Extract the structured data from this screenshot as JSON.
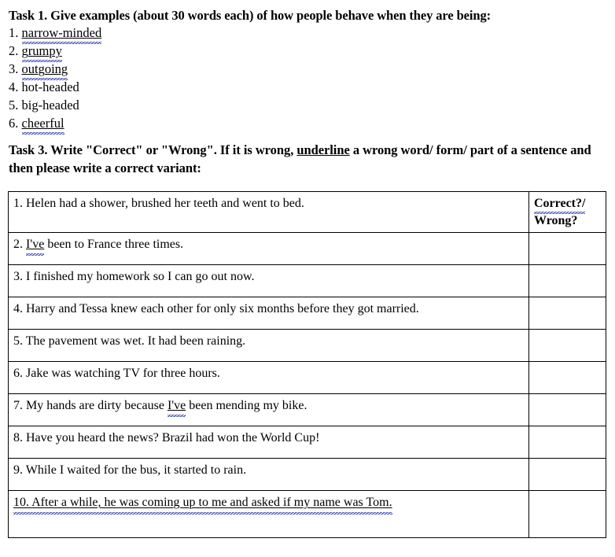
{
  "task1": {
    "heading": "Task 1. Give examples (about 30 words each) of how people behave when they are being:",
    "items": [
      {
        "number": "1.",
        "text": "narrow-minded",
        "underline": "solid-wavy"
      },
      {
        "number": "2.",
        "text": "grumpy",
        "underline": "solid-wavy"
      },
      {
        "number": "3.",
        "text": "outgoing",
        "underline": "solid-wavy"
      },
      {
        "number": "4.",
        "text": "hot-headed",
        "underline": "none"
      },
      {
        "number": "5.",
        "text": "big-headed",
        "underline": "none"
      },
      {
        "number": "6.",
        "text": "cheerful",
        "underline": "solid-wavy"
      }
    ]
  },
  "task3": {
    "heading_part1": "Task 3. Write \"Correct\" or \"Wrong\". If it is wrong, ",
    "heading_underlined": "underline",
    "heading_part2": " a wrong word/ form/ part of a sentence and then please write a correct variant:",
    "table": {
      "answer_header_line1": "Correct?/",
      "answer_header_line2": "Wrong?",
      "rows": [
        {
          "number": "1.",
          "sentence": "Helen had a shower, brushed her teeth and went to bed.",
          "answer": "",
          "marked_word": "",
          "fully_underlined": false
        },
        {
          "number": "2.",
          "sentence_before": "",
          "marked_word": "I've",
          "sentence_after": " been to France three times.",
          "sentence": "I've been to France three times.",
          "answer": "",
          "fully_underlined": false
        },
        {
          "number": "3.",
          "sentence": "I finished my homework so I can go out now.",
          "answer": "",
          "marked_word": "",
          "fully_underlined": false
        },
        {
          "number": "4.",
          "sentence": "Harry and Tessa knew each other for only six months before they got married.",
          "answer": "",
          "marked_word": "",
          "fully_underlined": false
        },
        {
          "number": "5.",
          "sentence": "The pavement was wet. It had been raining.",
          "answer": "",
          "marked_word": "",
          "fully_underlined": false
        },
        {
          "number": "6.",
          "sentence": "Jake was watching TV for three hours.",
          "answer": "",
          "marked_word": "",
          "fully_underlined": false
        },
        {
          "number": "7.",
          "sentence_before": "My hands are dirty because ",
          "marked_word": "I've",
          "sentence_after": " been mending my bike.",
          "sentence": "My hands are dirty because I've been mending my bike.",
          "answer": "",
          "fully_underlined": false
        },
        {
          "number": "8.",
          "sentence": "Have you heard the news? Brazil had won the World Cup!",
          "answer": "",
          "marked_word": "",
          "fully_underlined": false
        },
        {
          "number": "9.",
          "sentence": "While I waited for the bus, it started to rain.",
          "answer": "",
          "marked_word": "",
          "fully_underlined": false
        },
        {
          "number": "10.",
          "sentence": "After a while, he was coming up to me and asked if my name was Tom.",
          "answer": "",
          "marked_word": "",
          "fully_underlined": true
        }
      ]
    }
  },
  "colors": {
    "text": "#000000",
    "border": "#000000",
    "spellcheck_underline": "#2030a8",
    "background": "#ffffff"
  }
}
